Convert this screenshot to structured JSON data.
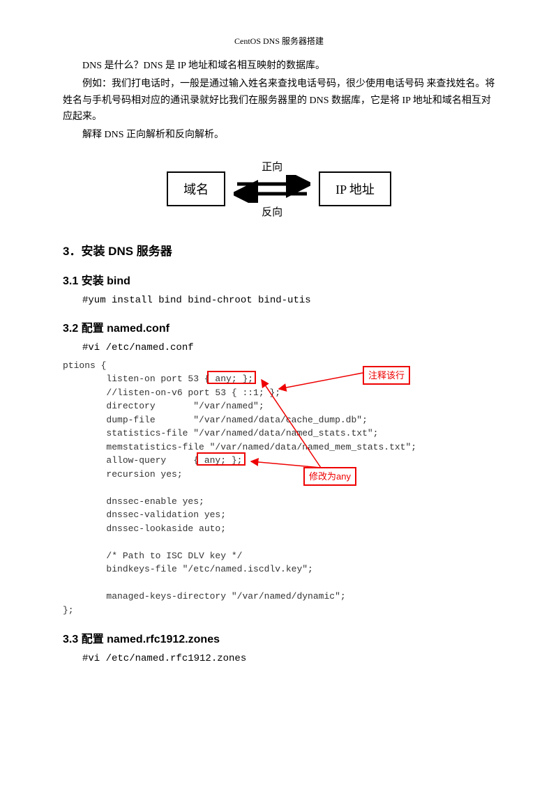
{
  "header": "CentOS DNS 服务器搭建",
  "intro": {
    "p1": "DNS 是什么？DNS 是 IP 地址和域名相互映射的数据库。",
    "p2": "例如：我们打电话时，一般是通过输入姓名来查找电话号码，很少使用电话号码  来查找姓名。将姓名与手机号码相对应的通讯录就好比我们在服务器里的 DNS 数据库，它是将 IP 地址和域名相互对应起来。",
    "p3": "解释 DNS 正向解析和反向解析。"
  },
  "diagram": {
    "left": "域名",
    "right": "IP 地址",
    "top": "正向",
    "bottom": "反向"
  },
  "sec3": "3．安装 DNS 服务器",
  "sec31": "3.1 安装 bind",
  "cmd31": "#yum install bind bind-chroot bind-utis",
  "sec32": "3.2 配置 named.conf",
  "cmd32": "#vi /etc/named.conf",
  "code32": "ptions {\n        listen-on port 53 { any; };\n        //listen-on-v6 port 53 { ::1; };\n        directory       \"/var/named\";\n        dump-file       \"/var/named/data/cache_dump.db\";\n        statistics-file \"/var/named/data/named_stats.txt\";\n        memstatistics-file \"/var/named/data/named_mem_stats.txt\";\n        allow-query     { any; };\n        recursion yes;\n\n        dnssec-enable yes;\n        dnssec-validation yes;\n        dnssec-lookaside auto;\n\n        /* Path to ISC DLV key */\n        bindkeys-file \"/etc/named.iscdlv.key\";\n\n        managed-keys-directory \"/var/named/dynamic\";\n};",
  "anno": {
    "comment_line": "注释该行",
    "change_to_any": "修改为any"
  },
  "sec33": "3.3 配置 named.rfc1912.zones",
  "cmd33": "#vi /etc/named.rfc1912.zones"
}
